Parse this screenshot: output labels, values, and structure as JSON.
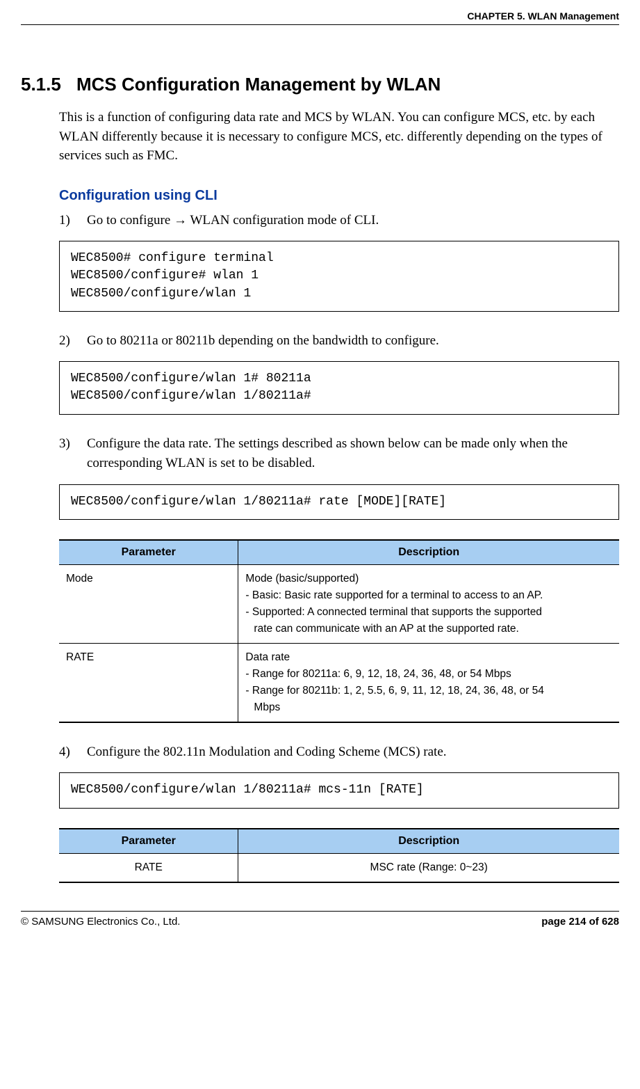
{
  "header": {
    "chapter": "CHAPTER 5. WLAN Management"
  },
  "section": {
    "number": "5.1.5",
    "title": "MCS Configuration Management by WLAN",
    "intro": "This is a function of configuring data rate and MCS by WLAN. You can configure MCS, etc. by each WLAN differently because it is necessary to configure MCS, etc. differently depending on the types of services such as FMC."
  },
  "subheading": "Configuration using CLI",
  "steps": {
    "s1": {
      "num": "1)",
      "text": "Go to configure → WLAN configuration mode of CLI."
    },
    "s2": {
      "num": "2)",
      "text": "Go to 80211a or 80211b depending on the bandwidth to configure."
    },
    "s3": {
      "num": "3)",
      "text": "Configure the data rate. The settings described as shown below can be made only when the corresponding WLAN is set to be disabled."
    },
    "s4": {
      "num": "4)",
      "text": "Configure the 802.11n Modulation and Coding Scheme (MCS) rate."
    }
  },
  "code": {
    "c1": "WEC8500# configure terminal\nWEC8500/configure# wlan 1\nWEC8500/configure/wlan 1",
    "c2": "WEC8500/configure/wlan 1# 80211a\nWEC8500/configure/wlan 1/80211a#",
    "c3": "WEC8500/configure/wlan 1/80211a# rate [MODE][RATE]",
    "c4": "WEC8500/configure/wlan 1/80211a# mcs-11n [RATE]"
  },
  "table1": {
    "hparam": "Parameter",
    "hdesc": "Description",
    "r1p": "Mode",
    "r1d1": "Mode (basic/supported)",
    "r1d2": "- Basic: Basic rate supported for a terminal to access to an AP.",
    "r1d3": "- Supported: A connected terminal that supports the supported",
    "r1d3b": "rate can communicate with an AP at the supported rate.",
    "r2p": "RATE",
    "r2d1": "Data rate",
    "r2d2": "- Range for 80211a: 6, 9, 12, 18, 24, 36, 48, or 54 Mbps",
    "r2d3": "- Range for 80211b: 1, 2, 5.5, 6, 9, 11, 12, 18, 24, 36, 48, or 54",
    "r2d3b": "Mbps"
  },
  "table2": {
    "hparam": "Parameter",
    "hdesc": "Description",
    "r1p": "RATE",
    "r1d": "MSC rate (Range: 0~23)"
  },
  "footer": {
    "left": "© SAMSUNG Electronics Co., Ltd.",
    "right": "page 214 of 628"
  }
}
